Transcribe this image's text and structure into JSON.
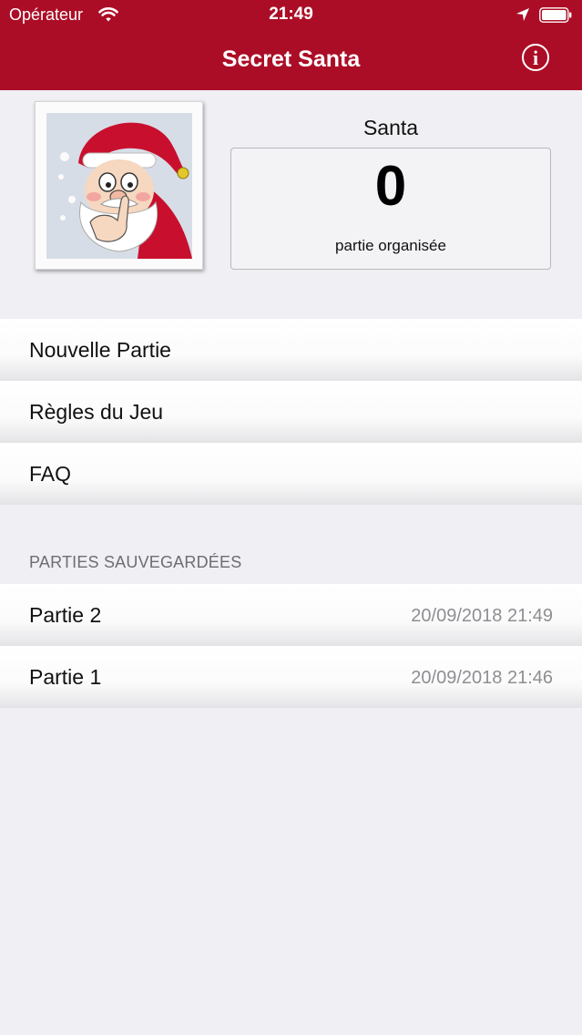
{
  "status_bar": {
    "carrier": "Opérateur",
    "time": "21:49"
  },
  "nav": {
    "title": "Secret Santa",
    "info_label": "i"
  },
  "profile": {
    "name": "Santa",
    "games_count": "0",
    "games_label": "partie organisée"
  },
  "menu": {
    "new_game": "Nouvelle Partie",
    "rules": "Règles du Jeu",
    "faq": "FAQ"
  },
  "saved": {
    "header": "PARTIES SAUVEGARDÉES",
    "items": [
      {
        "name": "Partie 2",
        "date": "20/09/2018 21:49"
      },
      {
        "name": "Partie 1",
        "date": "20/09/2018 21:46"
      }
    ]
  },
  "colors": {
    "brand": "#ac0d26",
    "background": "#efeff4",
    "secondary_text": "#8e8e93"
  }
}
